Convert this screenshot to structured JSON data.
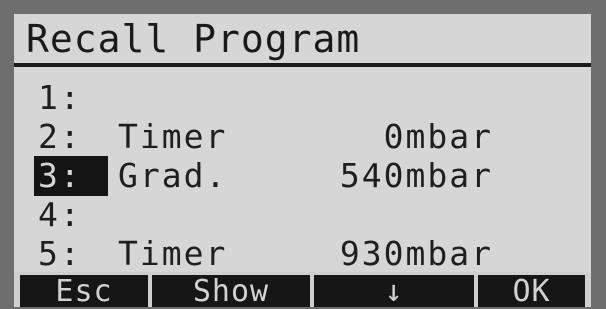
{
  "screen": {
    "title": "Recall Program",
    "rows": [
      {
        "num": "1:",
        "program": "",
        "value": "",
        "selected": false
      },
      {
        "num": "2:",
        "program": "Timer",
        "value": "0mbar",
        "selected": false
      },
      {
        "num": "3:",
        "program": "Grad.",
        "value": "540mbar",
        "selected": true
      },
      {
        "num": "4:",
        "program": "",
        "value": "",
        "selected": false
      },
      {
        "num": "5:",
        "program": "Timer",
        "value": "930mbar",
        "selected": false
      }
    ]
  },
  "softkeys": {
    "esc": "Esc",
    "show": "Show",
    "down": "↓",
    "ok": "OK"
  }
}
